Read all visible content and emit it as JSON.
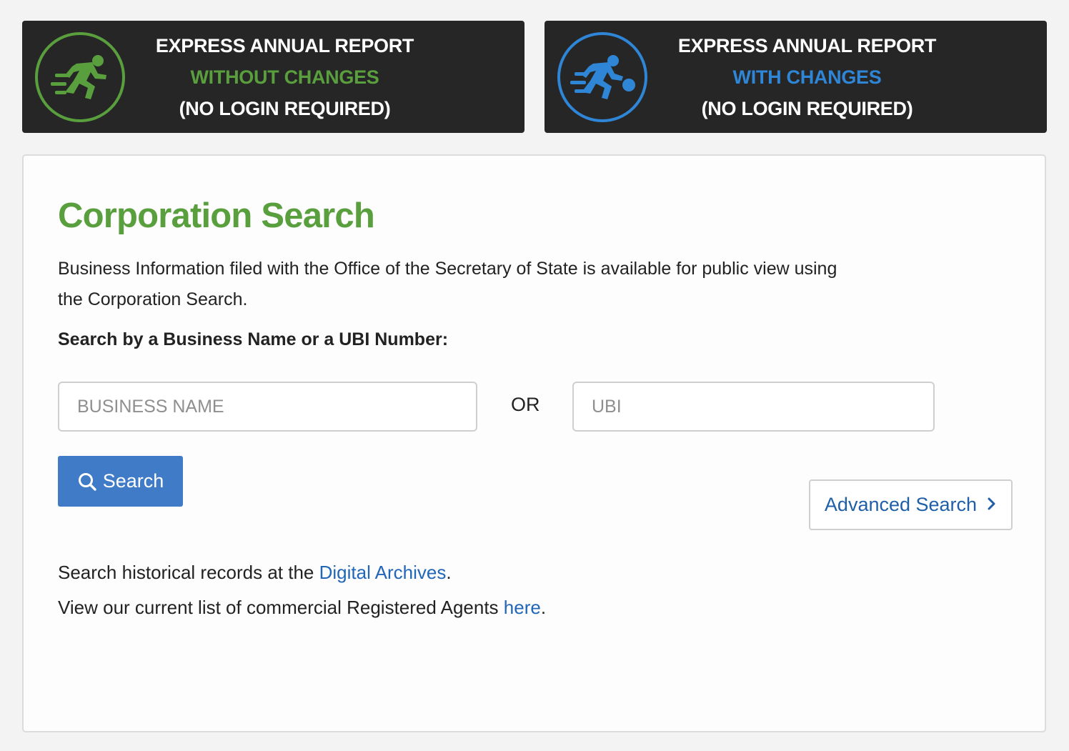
{
  "express_without": {
    "line1": "EXPRESS ANNUAL REPORT",
    "line2": "WITHOUT CHANGES",
    "line3": "(NO LOGIN REQUIRED)",
    "accent": "#5a9f3e",
    "icon": "runner-icon"
  },
  "express_with": {
    "line1": "EXPRESS ANNUAL REPORT",
    "line2": "WITH CHANGES",
    "line3": "(NO LOGIN REQUIRED)",
    "accent": "#2f86d6",
    "icon": "runner-with-ball-icon"
  },
  "search": {
    "title": "Corporation Search",
    "intro": "Business Information filed with the Office of the Secretary of State is available for public view using the Corporation Search.",
    "label": "Search by a Business Name or a UBI Number:",
    "business_name_placeholder": "BUSINESS NAME",
    "business_name_value": "",
    "or_label": "OR",
    "ubi_placeholder": "UBI",
    "ubi_value": "",
    "search_button": "Search",
    "advanced_button": "Advanced Search"
  },
  "footer": {
    "archives_prefix": "Search historical records at the ",
    "archives_link": "Digital Archives",
    "archives_suffix": ".",
    "agents_prefix": "View our current list of commercial Registered Agents ",
    "agents_link": "here",
    "agents_suffix": "."
  },
  "colors": {
    "banner_bg": "#262626",
    "title_green": "#5a9f3e",
    "button_blue": "#3f7bc7",
    "link_blue": "#2266b8"
  }
}
